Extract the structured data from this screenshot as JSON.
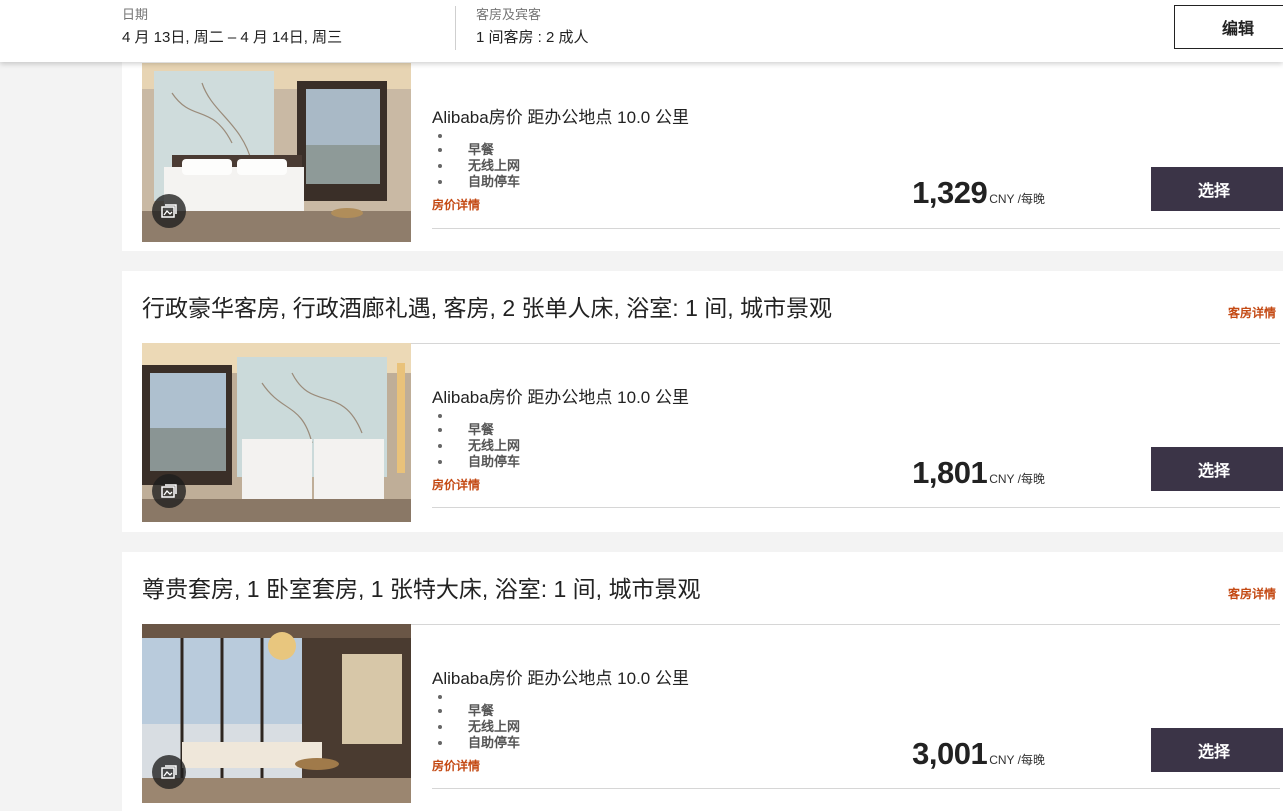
{
  "header": {
    "date_label": "日期",
    "date_value": "4 月 13日, 周二 – 4 月 14日, 周三",
    "guests_label": "客房及宾客",
    "guests_value": "1 间客房 : 2 成人",
    "edit_label": "编辑"
  },
  "rooms": [
    {
      "title": "",
      "details_link": "",
      "rate_name": "Alibaba房价 距办公地点 10.0 公里",
      "amenities": [
        "早餐",
        "无线上网",
        "自助停车"
      ],
      "rate_details_link": "房价详情",
      "price": "1,329",
      "price_unit": "CNY /每晚",
      "select_label": "选择"
    },
    {
      "title": "行政豪华客房, 行政酒廊礼遇, 客房, 2 张单人床, 浴室: 1 间, 城市景观",
      "details_link": "客房详情",
      "rate_name": "Alibaba房价 距办公地点 10.0 公里",
      "amenities": [
        "早餐",
        "无线上网",
        "自助停车"
      ],
      "rate_details_link": "房价详情",
      "price": "1,801",
      "price_unit": "CNY /每晚",
      "select_label": "选择"
    },
    {
      "title": "尊贵套房, 1 卧室套房, 1 张特大床, 浴室: 1 间, 城市景观",
      "details_link": "客房详情",
      "rate_name": "Alibaba房价 距办公地点 10.0 公里",
      "amenities": [
        "早餐",
        "无线上网",
        "自助停车"
      ],
      "rate_details_link": "房价详情",
      "price": "3,001",
      "price_unit": "CNY /每晚",
      "select_label": "选择"
    }
  ],
  "icons": {
    "gallery": "image-gallery-icon",
    "bullet": "bullet-dot-icon"
  },
  "colors": {
    "accent_link": "#c44a14",
    "select_button": "#3b3447",
    "page_background": "#f3f3f3"
  }
}
